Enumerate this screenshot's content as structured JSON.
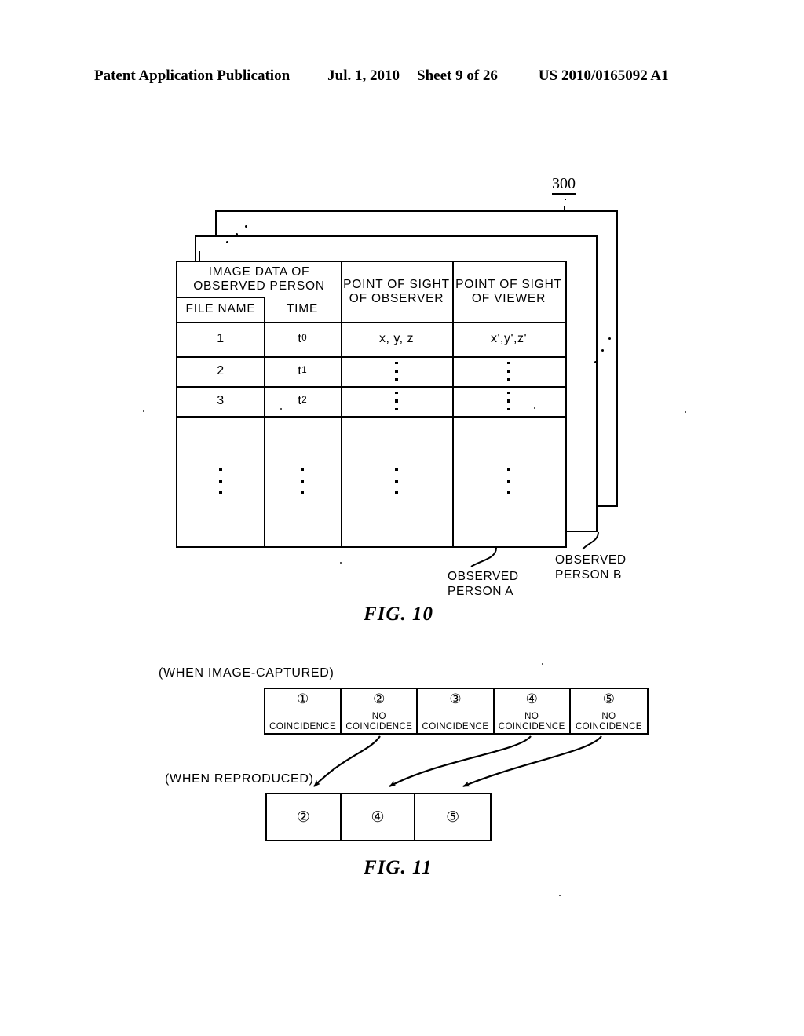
{
  "header": {
    "publication": "Patent Application Publication",
    "date": "Jul. 1, 2010",
    "sheet": "Sheet 9 of 26",
    "number": "US 2010/0165092 A1"
  },
  "fig10": {
    "caption": "FIG. 10",
    "reference_numeral": "300",
    "table": {
      "group_header": "IMAGE DATA OF\nOBSERVED PERSON",
      "columns": [
        "FILE NAME",
        "TIME",
        "POINT OF SIGHT\nOF OBSERVER",
        "POINT OF SIGHT\nOF VIEWER"
      ],
      "rows": [
        {
          "file_name": "1",
          "time_base": "t",
          "time_sub": "0",
          "observer": "x, y, z",
          "viewer": "x',y',z'"
        },
        {
          "file_name": "2",
          "time_base": "t",
          "time_sub": "1",
          "observer": "⋮",
          "viewer": "⋮"
        },
        {
          "file_name": "3",
          "time_base": "t",
          "time_sub": "2",
          "observer": "⋮",
          "viewer": "⋮"
        }
      ],
      "continuation_row": "⋮"
    },
    "callouts": {
      "person_a": "OBSERVED\nPERSON A",
      "person_b": "OBSERVED\nPERSON B"
    }
  },
  "fig11": {
    "caption": "FIG. 11",
    "captured_label": "(WHEN IMAGE-CAPTURED)",
    "reproduced_label": "(WHEN REPRODUCED)",
    "captured_cells": [
      {
        "num": "①",
        "text": "COINCIDENCE"
      },
      {
        "num": "②",
        "text": "NO\nCOINCIDENCE"
      },
      {
        "num": "③",
        "text": "COINCIDENCE"
      },
      {
        "num": "④",
        "text": "NO\nCOINCIDENCE"
      },
      {
        "num": "⑤",
        "text": "NO\nCOINCIDENCE"
      }
    ],
    "reproduced_cells": [
      {
        "num": "②"
      },
      {
        "num": "④"
      },
      {
        "num": "⑤"
      }
    ]
  }
}
